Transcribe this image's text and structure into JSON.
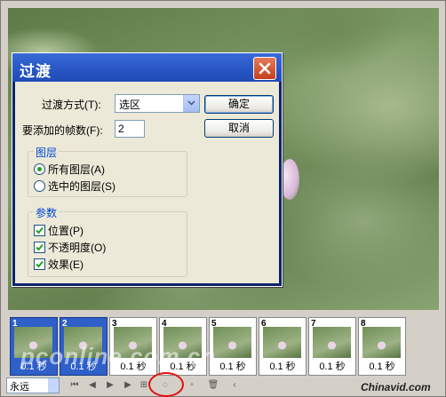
{
  "dialog": {
    "title": "过渡",
    "transition_label": "过渡方式(T):",
    "transition_value": "选区",
    "frames_label": "要添加的帧数(F):",
    "frames_value": "2",
    "ok_label": "确定",
    "cancel_label": "取消",
    "layers_group": {
      "title": "图层",
      "options": [
        {
          "label": "所有图层(A)",
          "selected": true
        },
        {
          "label": "选中的图层(S)",
          "selected": false
        }
      ]
    },
    "params_group": {
      "title": "参数",
      "options": [
        {
          "label": "位置(P)",
          "checked": true
        },
        {
          "label": "不透明度(O)",
          "checked": true
        },
        {
          "label": "效果(E)",
          "checked": true
        }
      ]
    }
  },
  "frames": [
    {
      "num": "1",
      "duration": "0.1 秒",
      "selected": true
    },
    {
      "num": "2",
      "duration": "0.1 秒",
      "selected": true
    },
    {
      "num": "3",
      "duration": "0.1 秒",
      "selected": false
    },
    {
      "num": "4",
      "duration": "0.1 秒",
      "selected": false
    },
    {
      "num": "5",
      "duration": "0.1 秒",
      "selected": false
    },
    {
      "num": "6",
      "duration": "0.1 秒",
      "selected": false
    },
    {
      "num": "7",
      "duration": "0.1 秒",
      "selected": false
    },
    {
      "num": "8",
      "duration": "0.1 秒",
      "selected": false
    }
  ],
  "toolbar": {
    "loop_value": "永远"
  },
  "watermark": "pconline.com.cn",
  "brand": "Chinavid.com",
  "colors": {
    "titlebar": "#2a58c8",
    "close": "#c2401c",
    "highlight_circle": "#e01010",
    "selected_frame": "#2f5fc8"
  }
}
